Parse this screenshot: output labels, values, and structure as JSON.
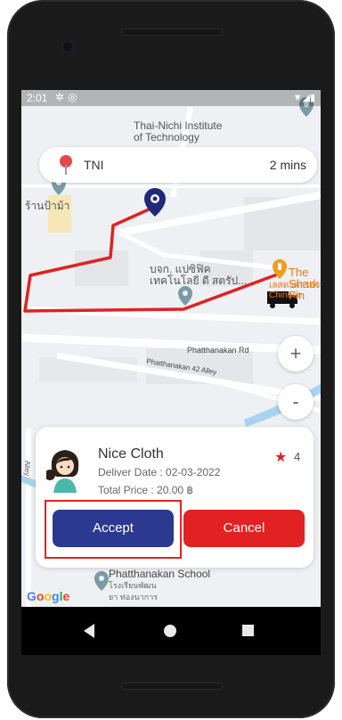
{
  "status_bar": {
    "time": "2:01",
    "icons": [
      "gear-icon",
      "circle-icon"
    ],
    "right_icons": [
      "wifi-icon",
      "signal-icon",
      "battery-icon"
    ]
  },
  "map": {
    "labels": {
      "institute": "Thai-Nichi Institute\nof Technology",
      "shop_left": "ร้านป้าม้า",
      "company": "บจก. แปซิฟิค\nเทคโนโลยี ดี สตรัป...",
      "restaurant": "The Shark Fin",
      "restaurant_sub": "เลสตาคารอาหารจีน\nChinese",
      "road": "Phatthanakan Rd",
      "alley": "Phatthanakan 42 Alley",
      "school": "Phatthanakan School",
      "school_sub": "โรงเรียนพัฒน\nยา ท่องนาการ",
      "side_road": "Alley"
    },
    "google": "Google"
  },
  "search": {
    "destination": "TNI",
    "eta": "2 mins"
  },
  "zoom": {
    "in": "+",
    "out": "-"
  },
  "order": {
    "item_name": "Nice Cloth",
    "deliver_date": "Deliver Date : 02-03-2022",
    "total_price": "Total Price : 20.00 ฿",
    "rating": "4",
    "accept_label": "Accept",
    "cancel_label": "Cancel"
  },
  "colors": {
    "accept": "#2b3990",
    "cancel": "#e22222",
    "route": "#e02222",
    "pin": "#1f2a7a"
  }
}
